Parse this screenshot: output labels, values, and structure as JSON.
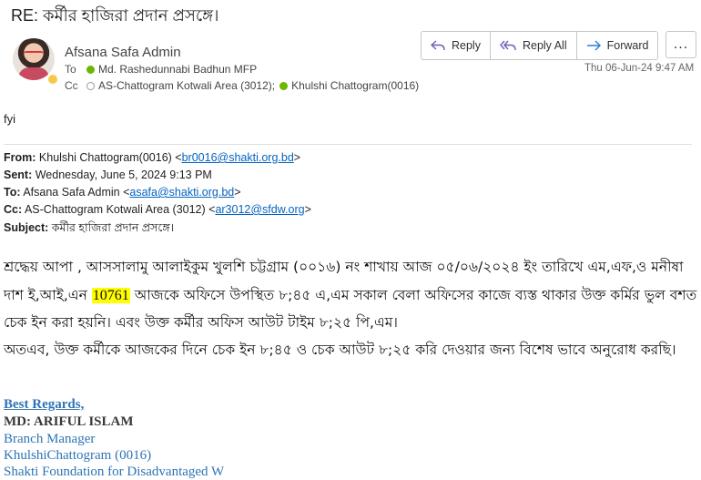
{
  "email": {
    "subject": "RE: কর্মীর হাজিরা প্রদান প্রসঙ্গে।",
    "sender": "Afsana Safa Admin",
    "to_label": "To",
    "to": "Md. Rashedunnabi Badhun MFP",
    "cc_label": "Cc",
    "cc_1": "AS-Chattogram Kotwali Area (3012);",
    "cc_2": "Khulshi Chattogram(0016)",
    "date": "Thu 06-Jun-24 9:47 AM",
    "actions": {
      "reply": "Reply",
      "reply_all": "Reply All",
      "forward": "Forward",
      "more": "..."
    },
    "body_intro": "fyi"
  },
  "quoted": {
    "from_label": "From:",
    "from": "Khulshi Chattogram(0016) <",
    "from_email": "br0016@shakti.org.bd",
    "from_end": ">",
    "sent_label": "Sent:",
    "sent": "Wednesday, June 5, 2024 9:13 PM",
    "to_label": "To:",
    "to": "Afsana Safa Admin <",
    "to_email": "asafa@shakti.org.bd",
    "to_end": ">",
    "cc_label": "Cc:",
    "cc": "AS-Chattogram Kotwali Area (3012) <",
    "cc_email": "ar3012@sfdw.org",
    "cc_end": ">",
    "subject_label": "Subject:",
    "subject": "কর্মীর হাজিরা প্রদান প্রসঙ্গে।"
  },
  "body": {
    "line1": "শ্রদ্ধেয় আপা , আসসালামু আলাইকুম খুলশি চট্টগ্রাম (০০১৬) নং শাখায় আজ ০৫/০৬/২০২৪ ইং তারিখে এম,এফ,ও মনীষা",
    "line2_pre": "দাশ ই,আই,এন ",
    "line2_hl": "10761",
    "line2_post": " আজকে অফিসে উপস্থিত ৮;৪৫ এ,এম সকাল বেলা অফিসের কাজে ব্যস্ত থাকার উক্ত কর্মির ভুল বশত",
    "line3": "চেক ইন করা হয়নি। এবং উক্ত কর্মীর অফিস আউট টাইম ৮;২৫ পি,এম।",
    "line4": "অতএব, উক্ত কর্মীকে আজকের দিনে চেক ইন ৮;৪৫ ও চেক আউট ৮;২৫ করি দেওয়ার জন্য বিশেষ ভাবে অনুরোধ করছি।"
  },
  "signature": {
    "regards": "Best Regards,",
    "name": "MD: ARIFUL ISLAM",
    "title": "Branch Manager",
    "branch": "KhulshiChattogram (0016)",
    "org": "Shakti Foundation for Disadvantaged W"
  },
  "colors": {
    "accent": "#0563c1",
    "highlight": "#ffff00",
    "signature": "#2e74b5"
  }
}
